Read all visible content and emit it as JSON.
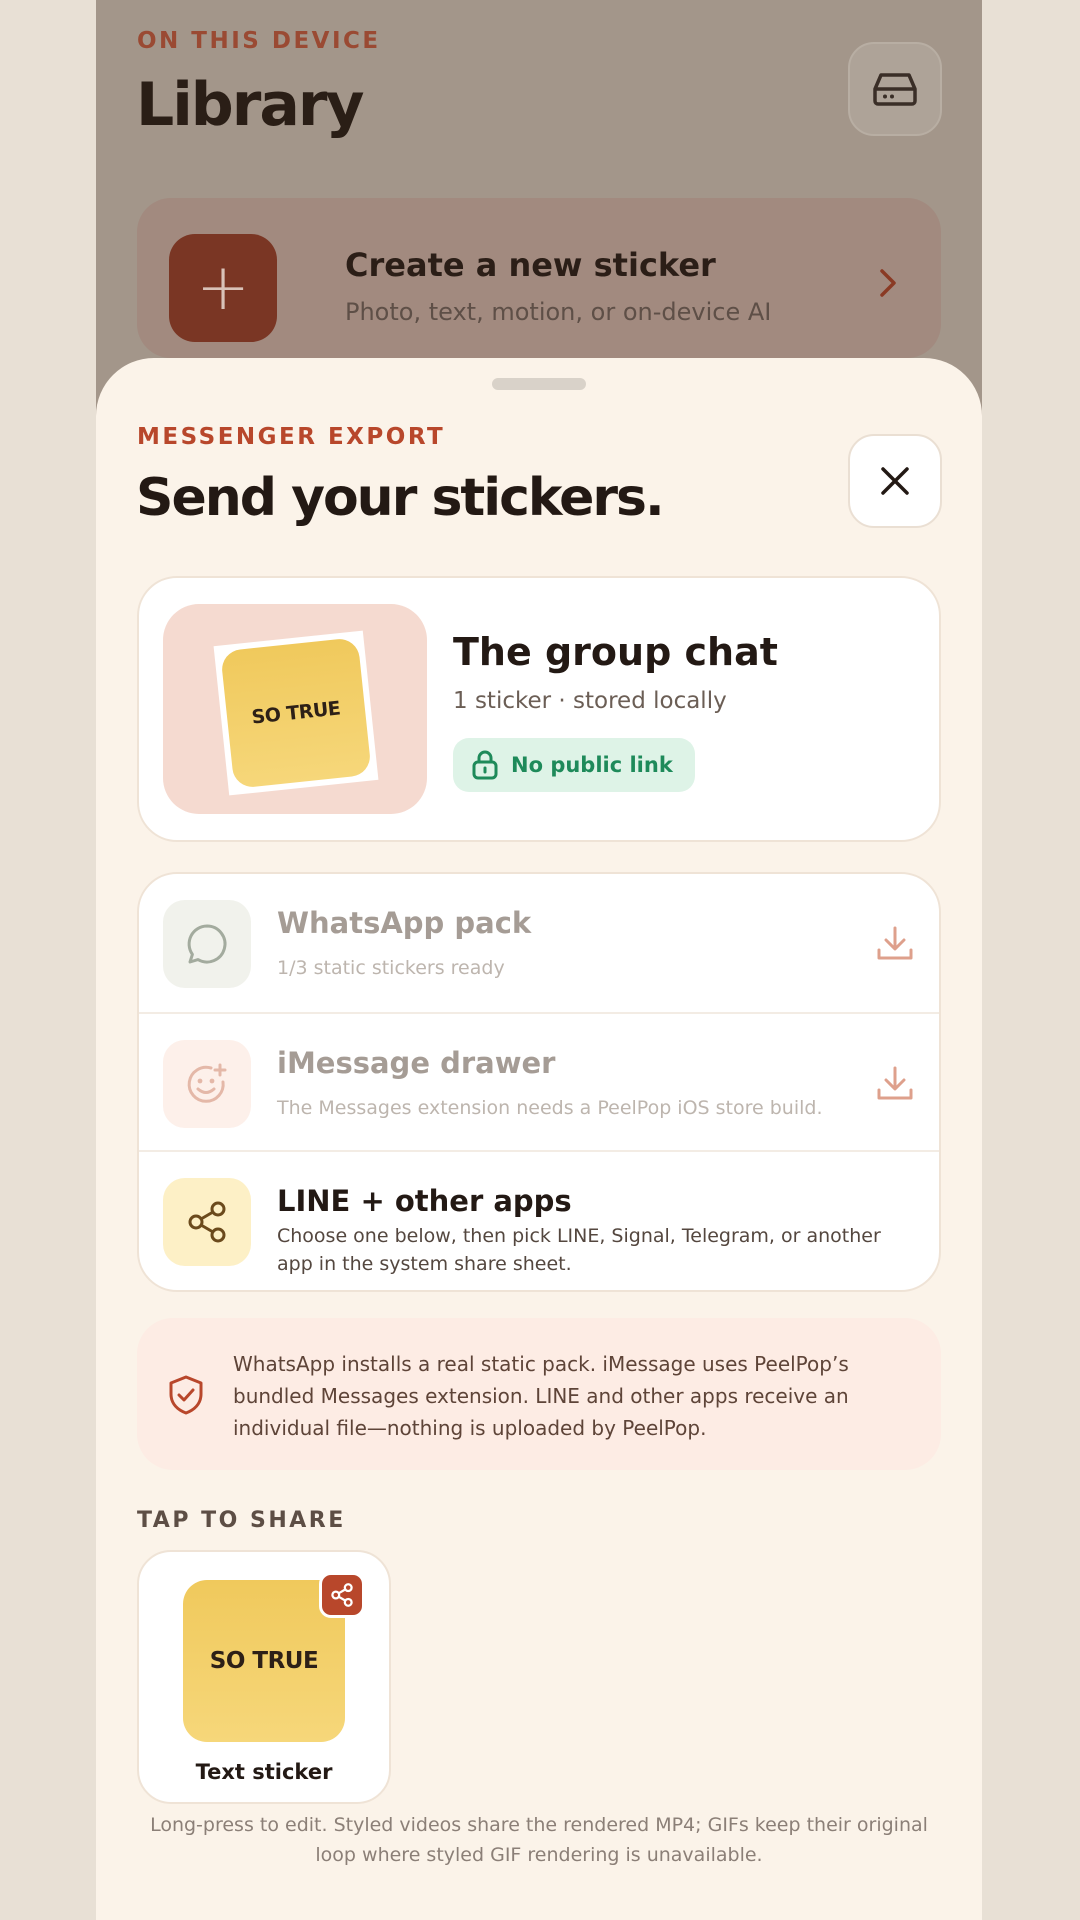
{
  "library": {
    "eyebrow": "ON THIS DEVICE",
    "title": "Library",
    "storage_icon": "drive-icon",
    "create": {
      "icon": "plus-icon",
      "plus_glyph": "+",
      "title": "Create a new sticker",
      "subtitle": "Photo, text, motion, or on-device AI"
    }
  },
  "sheet": {
    "eyebrow": "MESSENGER EXPORT",
    "title": "Send your stickers.",
    "pack": {
      "thumb_text": "SO TRUE",
      "name": "The group chat",
      "meta": "1 sticker · stored locally",
      "badge": "No public link"
    },
    "options": [
      {
        "icon": "chat-bubble-icon",
        "title": "WhatsApp pack",
        "subtitle": "1/3 static stickers ready",
        "enabled": false
      },
      {
        "icon": "smiley-add-icon",
        "title": "iMessage drawer",
        "subtitle": "The Messages extension needs a PeelPop iOS store build.",
        "enabled": false
      },
      {
        "icon": "share-icon",
        "title": "LINE + other apps",
        "subtitle": "Choose one below, then pick LINE, Signal, Telegram, or another app in the system share sheet.",
        "enabled": true
      }
    ],
    "info": "WhatsApp installs a real static pack. iMessage uses PeelPop’s bundled Messages extension. LINE and other apps receive an individual file—nothing is uploaded by PeelPop.",
    "tap_label": "TAP TO SHARE",
    "stickers": [
      {
        "text": "SO TRUE",
        "label": "Text sticker"
      }
    ],
    "footnote": "Long-press to edit. Styled videos share the rendered MP4; GIFs keep their original loop where styled GIF rendering is unavailable."
  },
  "colors": {
    "accent": "#b8472b",
    "green": "#1e8a5a",
    "sticker_yellow": "#f0c95c"
  }
}
